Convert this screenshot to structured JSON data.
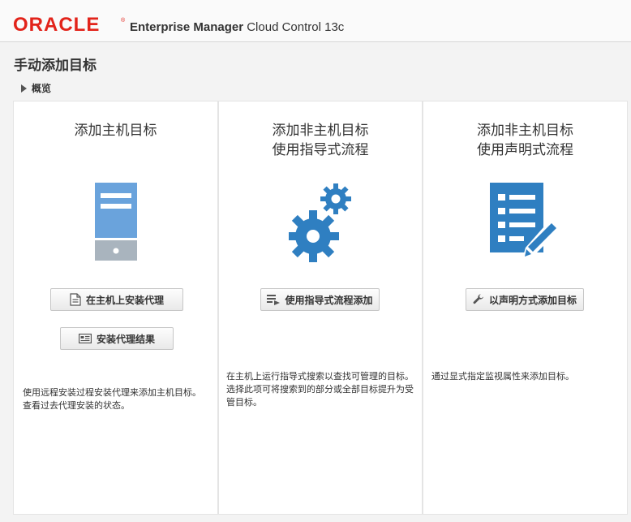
{
  "header": {
    "brand": "ORACLE",
    "product_name": "Enterprise Manager",
    "product_suffix": "Cloud Control 13c"
  },
  "page": {
    "title": "手动添加目标",
    "overview_label": "概览"
  },
  "panels": [
    {
      "title_line1": "添加主机目标",
      "title_line2": "",
      "buttons": [
        {
          "label": "在主机上安装代理",
          "icon": "document-add-icon"
        },
        {
          "label": "安装代理结果",
          "icon": "results-icon"
        }
      ],
      "description": "使用远程安装过程安装代理来添加主机目标。查看过去代理安装的状态。",
      "illustration": "server-icon"
    },
    {
      "title_line1": "添加非主机目标",
      "title_line2": "使用指导式流程",
      "buttons": [
        {
          "label": "使用指导式流程添加",
          "icon": "guided-list-icon"
        }
      ],
      "description": "在主机上运行指导式搜索以查找可管理的目标。选择此项可将搜索到的部分或全部目标提升为受管目标。",
      "illustration": "gears-icon"
    },
    {
      "title_line1": "添加非主机目标",
      "title_line2": "使用声明式流程",
      "buttons": [
        {
          "label": "以声明方式添加目标",
          "icon": "wrench-icon"
        }
      ],
      "description": "通过显式指定监视属性来添加目标。",
      "illustration": "checklist-pencil-icon"
    }
  ],
  "colors": {
    "brand_red": "#e2231a",
    "icon_blue": "#2f7fc1",
    "server_blue": "#5b9bd5",
    "server_gray": "#a9b4be"
  }
}
